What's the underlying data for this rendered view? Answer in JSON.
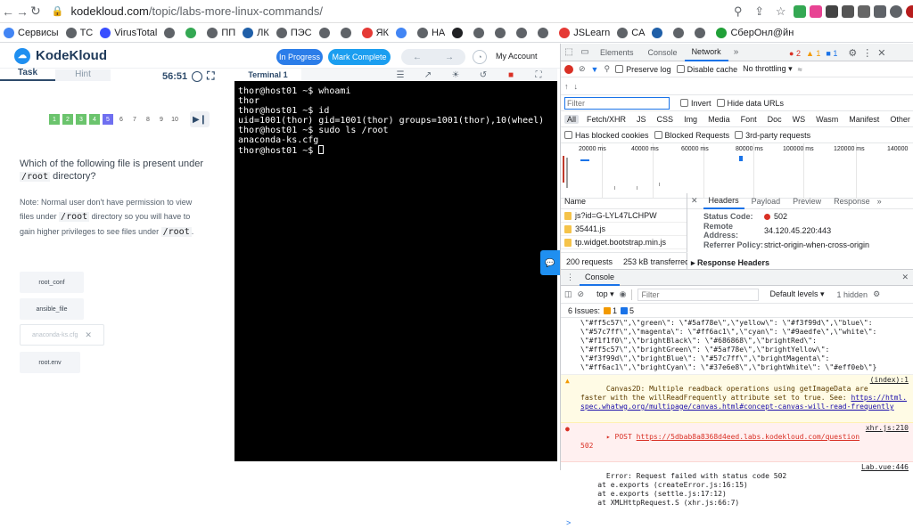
{
  "browser": {
    "url_host": "kodekloud.com",
    "url_path": "/topic/labs-more-linux-commands/",
    "bookmarks": [
      {
        "label": "Сервисы",
        "color": "#4285f4"
      },
      {
        "label": "TC",
        "color": "#5f6368"
      },
      {
        "label": "VirusTotal",
        "color": "#394eff"
      },
      {
        "label": "",
        "color": "#5f6368"
      },
      {
        "label": "",
        "color": "#34a853"
      },
      {
        "label": "ПП",
        "color": "#5f6368"
      },
      {
        "label": "ЛК",
        "color": "#1f5fa8"
      },
      {
        "label": "ПЭС",
        "color": "#5f6368"
      },
      {
        "label": "",
        "color": "#5f6368"
      },
      {
        "label": "",
        "color": "#5f6368"
      },
      {
        "label": "ЯК",
        "color": "#e53935"
      },
      {
        "label": "",
        "color": "#4285f4"
      },
      {
        "label": "НА",
        "color": "#5f6368"
      },
      {
        "label": "",
        "color": "#202124"
      },
      {
        "label": "",
        "color": "#5f6368"
      },
      {
        "label": "",
        "color": "#5f6368"
      },
      {
        "label": "",
        "color": "#5f6368"
      },
      {
        "label": "",
        "color": "#5f6368"
      },
      {
        "label": "JSLearn",
        "color": "#e53935"
      },
      {
        "label": "CA",
        "color": "#5f6368"
      },
      {
        "label": "",
        "color": "#1f5fa8"
      },
      {
        "label": "",
        "color": "#5f6368"
      },
      {
        "label": "",
        "color": "#5f6368"
      },
      {
        "label": "СберОнл@йн",
        "color": "#21a038"
      }
    ]
  },
  "kodekloud": {
    "logo": "KodeKloud",
    "in_progress": "In Progress",
    "mark_complete": "Mark Complete",
    "my_account": "My Account",
    "tab_task": "Task",
    "tab_hint": "Hint",
    "timer": "56:51",
    "steps": [
      "1",
      "2",
      "3",
      "4",
      "5",
      "6",
      "7",
      "8",
      "9",
      "10"
    ],
    "current_step": 5,
    "question_pre": "Which of the following file is present under",
    "question_code": "/root",
    "question_post": "directory?",
    "note_1": "Note: Normal user don't have permission to view files under",
    "note_code_1": "/root",
    "note_2": "directory so you will have to gain higher privileges to see files under",
    "note_code_2": "/root",
    "note_3": ".",
    "options": [
      "root_conf",
      "ansible_file",
      "anaconda-ks.cfg",
      "root.env"
    ],
    "terminal_tab": "Terminal 1",
    "terminal_lines": [
      "thor@host01 ~$ whoami",
      "thor",
      "thor@host01 ~$ id",
      "uid=1001(thor) gid=1001(thor) groups=1001(thor),10(wheel)",
      "thor@host01 ~$ sudo ls /root",
      "anaconda-ks.cfg",
      "thor@host01 ~$ "
    ]
  },
  "devtools": {
    "tabs": [
      "Elements",
      "Console",
      "Network"
    ],
    "active_tab": "Network",
    "errors": "2",
    "warnings": "1",
    "info": "1",
    "preserve_log": "Preserve log",
    "disable_cache": "Disable cache",
    "throttling": "No throttling",
    "filter_placeholder": "Filter",
    "invert": "Invert",
    "hide_data_urls": "Hide data URLs",
    "types": [
      "All",
      "Fetch/XHR",
      "JS",
      "CSS",
      "Img",
      "Media",
      "Font",
      "Doc",
      "WS",
      "Wasm",
      "Manifest",
      "Other"
    ],
    "blocked_cookies": "Has blocked cookies",
    "blocked_requests": "Blocked Requests",
    "third_party": "3rd-party requests",
    "timeline_ticks": [
      "20000 ms",
      "40000 ms",
      "60000 ms",
      "80000 ms",
      "100000 ms",
      "120000 ms",
      "140000"
    ],
    "name_header": "Name",
    "requests": [
      "js?id=G-LYL47LCHPW",
      "35441.js",
      "tp.widget.bootstrap.min.js"
    ],
    "status_requests": "200 requests",
    "status_transferred": "253 kB transferred",
    "header_tabs": [
      "Headers",
      "Payload",
      "Preview",
      "Response"
    ],
    "status_code_label": "Status Code:",
    "status_code": "502",
    "remote_address_label": "Remote Address:",
    "remote_address": "34.120.45.220:443",
    "referrer_policy_label": "Referrer Policy:",
    "referrer_policy": "strict-origin-when-cross-origin",
    "response_headers": "Response Headers",
    "console_tab": "Console",
    "context": "top",
    "console_filter": "Filter",
    "default_levels": "Default levels",
    "hidden": "1 hidden",
    "issues_label": "6 Issues:",
    "issues_warn": "1",
    "issues_info": "5",
    "log_json": "\\\"#ff5c57\\\",\\\"green\\\": \\\"#5af78e\\\",\\\"yellow\\\": \\\"#f3f99d\\\",\\\"blue\\\":\n\\\"#57c7ff\\\",\\\"magenta\\\": \\\"#ff6ac1\\\",\\\"cyan\\\": \\\"#9aedfe\\\",\\\"white\\\":\n\\\"#f1f1f0\\\",\\\"brightBlack\\\": \\\"#686868\\\",\\\"brightRed\\\":\n\\\"#ff5c57\\\",\\\"brightGreen\\\": \\\"#5af78e\\\",\\\"brightYellow\\\":\n\\\"#f3f99d\\\",\\\"brightBlue\\\": \\\"#57c7ff\\\",\\\"brightMagenta\\\":\n\\\"#ff6ac1\\\",\\\"brightCyan\\\": \\\"#37e6e8\\\",\\\"brightWhite\\\": \\\"#eff0eb\\\"}",
    "warn_text": "Canvas2D: Multiple readback operations using getImageData are\nfaster with the willReadFrequently attribute set to true. See: ",
    "warn_link": "https://html.\nspec.whatwg.org/multipage/canvas.html#concept-canvas-will-read-frequently",
    "warn_src": "(index):1",
    "err_method": "POST",
    "err_url": "https://5dbab8a8368d4eed.labs.kodekloud.com/question",
    "err_code": "502",
    "err_src": "xhr.js:210",
    "err2_text": "Error: Request failed with status code 502",
    "err2_src": "Lab.vue:446",
    "stack": [
      "at e.exports (createError.js:16:15)",
      "at e.exports (settle.js:17:12)",
      "at XMLHttpRequest.S (xhr.js:66:7)"
    ],
    "prompt": ">"
  }
}
